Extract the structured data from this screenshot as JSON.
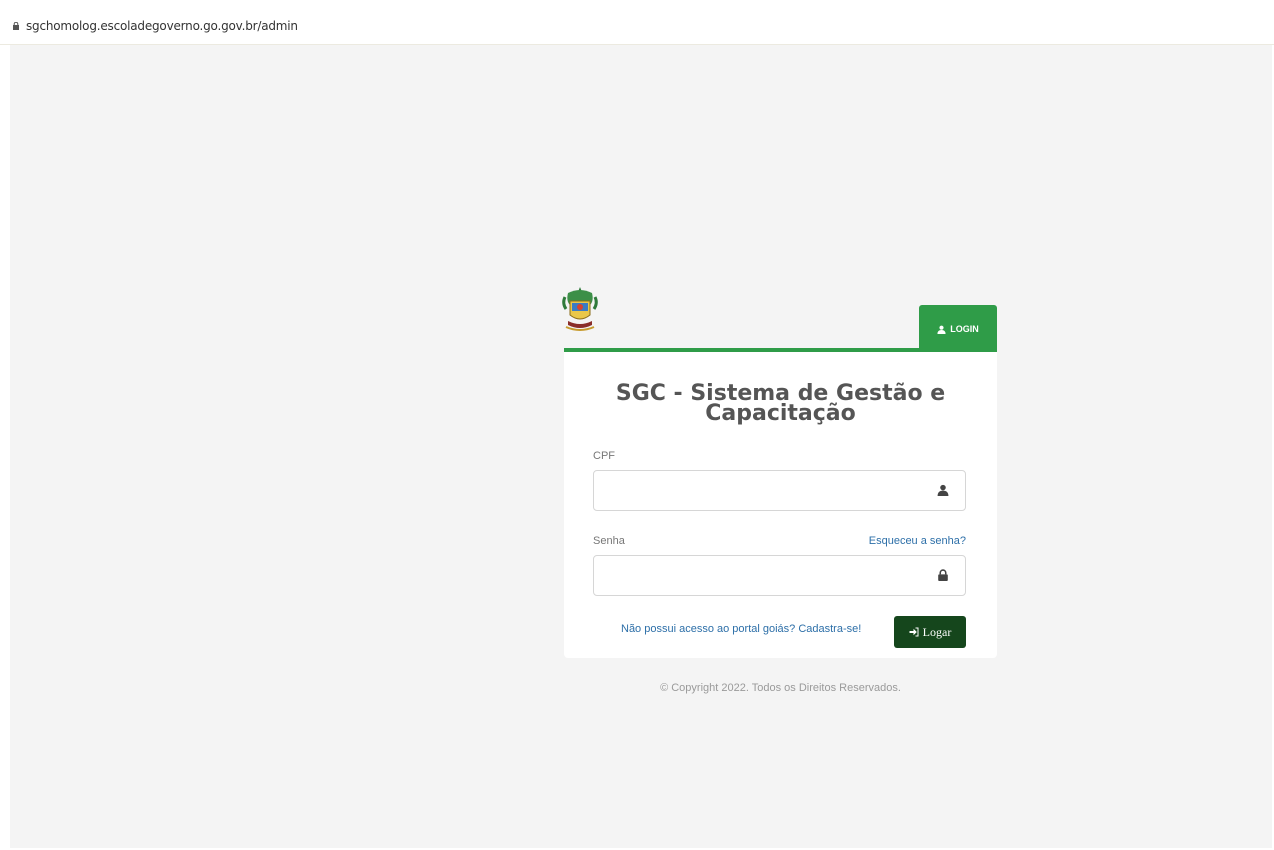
{
  "browser": {
    "url": "sgchomolog.escoladegoverno.go.gov.br/admin"
  },
  "login_tab": {
    "label": "LOGIN"
  },
  "form": {
    "title_line1": "SGC - Sistema de Gestão e",
    "title_line2": "Capacitação",
    "cpf_label": "CPF",
    "cpf_value": "",
    "password_label": "Senha",
    "password_value": "",
    "forgot_label": "Esqueceu a senha?",
    "register_label": "Não possui acesso ao portal goiás? Cadastra-se!",
    "submit_label": "Logar"
  },
  "footer": {
    "copyright": "© Copyright 2022. Todos os Direitos Reservados."
  },
  "icons": {
    "cpf_field_icon": "user-icon",
    "password_field_icon": "lock-icon",
    "submit_icon": "sign-in-icon",
    "tab_icon": "user-icon"
  },
  "colors": {
    "accent_green": "#2f9c48",
    "button_dark_green": "#15461c",
    "link_blue": "#2d6fa8"
  }
}
